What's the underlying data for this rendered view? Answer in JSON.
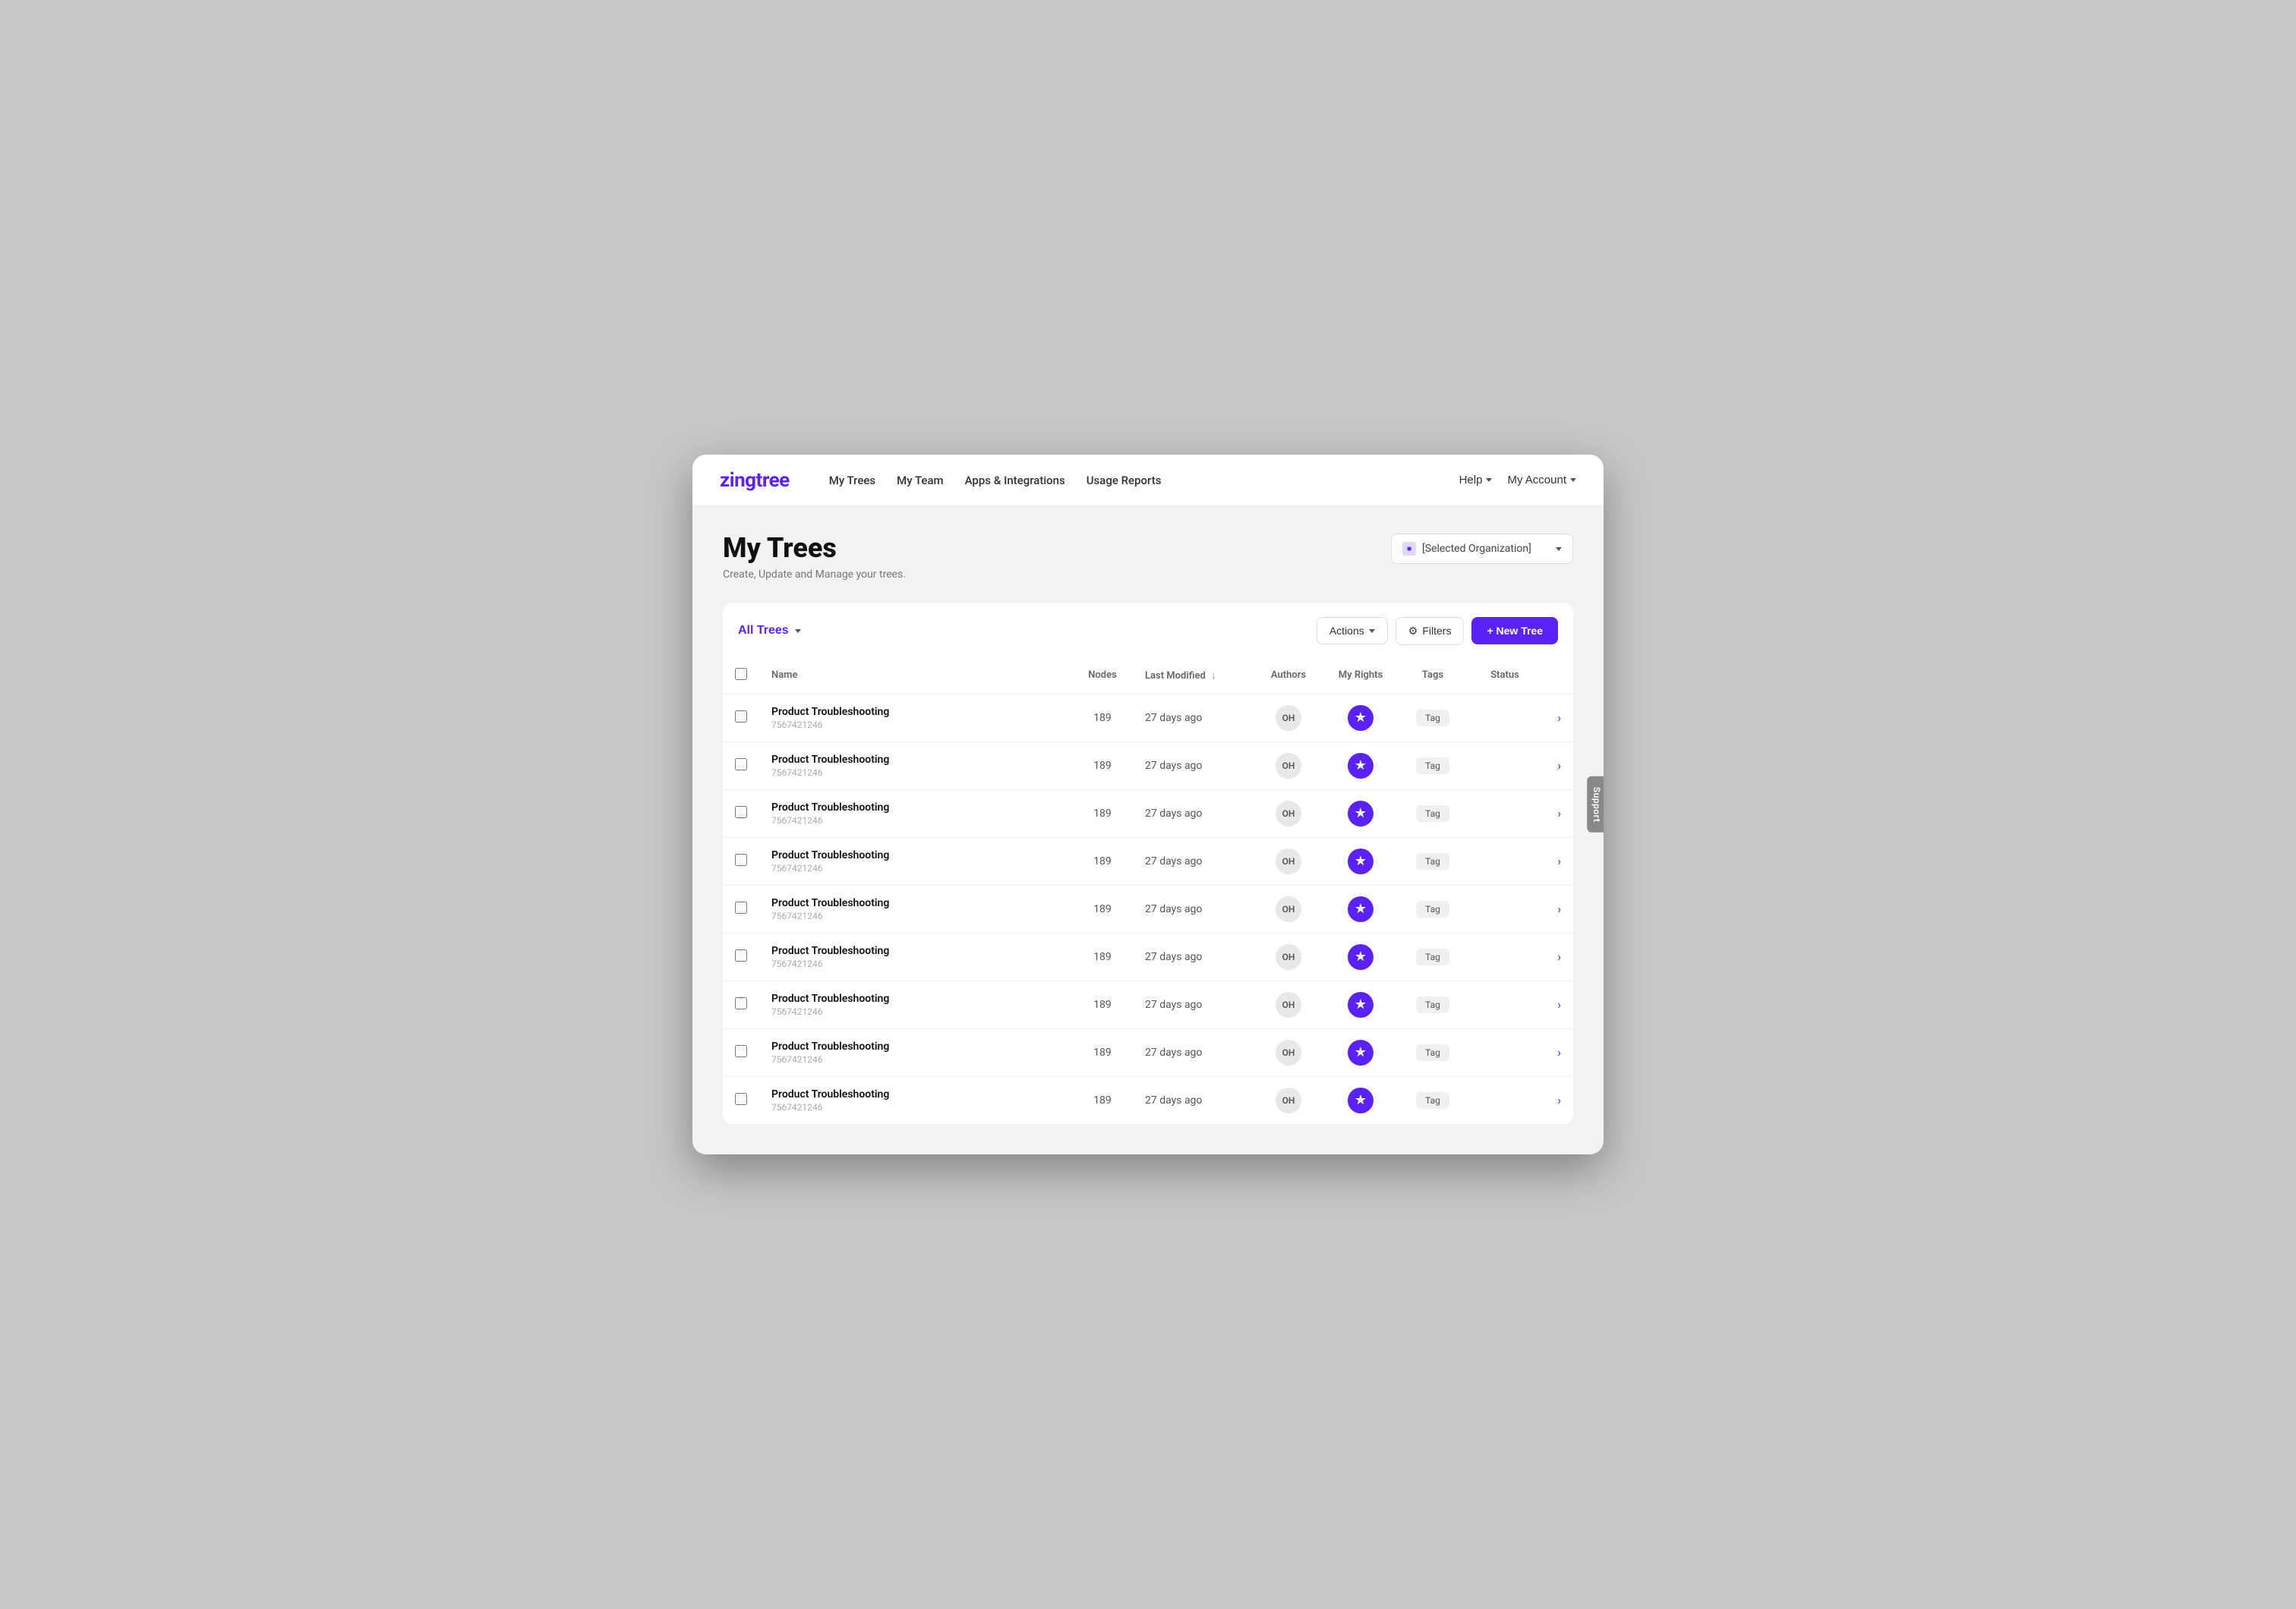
{
  "app": {
    "logo": "zingtree",
    "brand_color": "#5b21f5"
  },
  "nav": {
    "links": [
      {
        "id": "my-trees",
        "label": "My Trees"
      },
      {
        "id": "my-team",
        "label": "My Team"
      },
      {
        "id": "apps-integrations",
        "label": "Apps & Integrations"
      },
      {
        "id": "usage-reports",
        "label": "Usage Reports"
      }
    ],
    "right": [
      {
        "id": "help",
        "label": "Help",
        "has_chevron": true
      },
      {
        "id": "my-account",
        "label": "My Account",
        "has_chevron": true
      }
    ]
  },
  "page": {
    "title": "My Trees",
    "subtitle": "Create, Update and Manage your trees."
  },
  "org_selector": {
    "label": "[Selected Organization]"
  },
  "toolbar": {
    "filter_label": "All Trees",
    "actions_label": "Actions",
    "filters_label": "Filters",
    "new_tree_label": "+ New Tree"
  },
  "table": {
    "columns": [
      {
        "id": "check",
        "label": ""
      },
      {
        "id": "name",
        "label": "Name"
      },
      {
        "id": "nodes",
        "label": "Nodes"
      },
      {
        "id": "last_modified",
        "label": "Last Modified"
      },
      {
        "id": "authors",
        "label": "Authors"
      },
      {
        "id": "my_rights",
        "label": "My Rights"
      },
      {
        "id": "tags",
        "label": "Tags"
      },
      {
        "id": "status",
        "label": "Status"
      },
      {
        "id": "chevron",
        "label": ""
      }
    ],
    "rows": [
      {
        "name": "Product Troubleshooting",
        "id": "7567421246",
        "nodes": 189,
        "last_modified": "27 days ago",
        "author": "OH",
        "tag": "Tag"
      },
      {
        "name": "Product Troubleshooting",
        "id": "7567421246",
        "nodes": 189,
        "last_modified": "27 days ago",
        "author": "OH",
        "tag": "Tag"
      },
      {
        "name": "Product Troubleshooting",
        "id": "7567421246",
        "nodes": 189,
        "last_modified": "27 days ago",
        "author": "OH",
        "tag": "Tag"
      },
      {
        "name": "Product Troubleshooting",
        "id": "7567421246",
        "nodes": 189,
        "last_modified": "27 days ago",
        "author": "OH",
        "tag": "Tag"
      },
      {
        "name": "Product Troubleshooting",
        "id": "7567421246",
        "nodes": 189,
        "last_modified": "27 days ago",
        "author": "OH",
        "tag": "Tag"
      },
      {
        "name": "Product Troubleshooting",
        "id": "7567421246",
        "nodes": 189,
        "last_modified": "27 days ago",
        "author": "OH",
        "tag": "Tag"
      },
      {
        "name": "Product Troubleshooting",
        "id": "7567421246",
        "nodes": 189,
        "last_modified": "27 days ago",
        "author": "OH",
        "tag": "Tag"
      },
      {
        "name": "Product Troubleshooting",
        "id": "7567421246",
        "nodes": 189,
        "last_modified": "27 days ago",
        "author": "OH",
        "tag": "Tag"
      },
      {
        "name": "Product Troubleshooting",
        "id": "7567421246",
        "nodes": 189,
        "last_modified": "27 days ago",
        "author": "OH",
        "tag": "Tag"
      }
    ]
  },
  "support_tab": {
    "label": "Support"
  }
}
